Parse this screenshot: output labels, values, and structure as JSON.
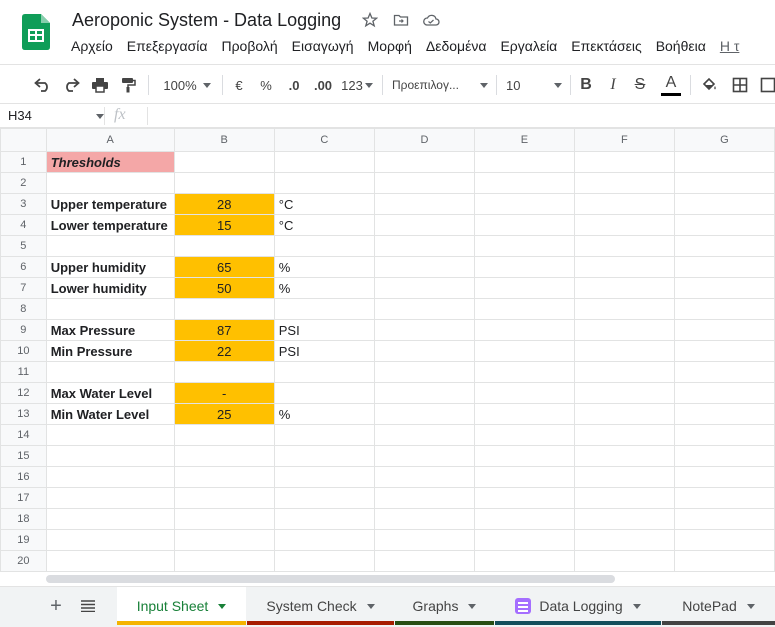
{
  "app": {
    "title": "Aeroponic System - Data Logging",
    "menu": [
      "Αρχείο",
      "Επεξεργασία",
      "Προβολή",
      "Εισαγωγή",
      "Μορφή",
      "Δεδομένα",
      "Εργαλεία",
      "Επεκτάσεις",
      "Βοήθεια",
      "Η τ"
    ]
  },
  "toolbar": {
    "zoom": "100%",
    "currency": "€",
    "percent": "%",
    "decrease_decimals": ".0",
    "increase_decimals": ".00",
    "format_more": "123",
    "font": "Προεπιλογ...",
    "font_size": "10",
    "bold": "B",
    "italic": "I",
    "strikethrough": "S",
    "text_color": "A"
  },
  "formula_bar": {
    "cell_ref": "H34",
    "fx": "fx"
  },
  "columns": [
    "A",
    "B",
    "C",
    "D",
    "E",
    "F",
    "G"
  ],
  "rows": [
    {
      "n": "1",
      "a": "Thresholds",
      "b": "",
      "c": ""
    },
    {
      "n": "2",
      "a": "",
      "b": "",
      "c": ""
    },
    {
      "n": "3",
      "a": "Upper temperature",
      "b": "28",
      "c": "°C"
    },
    {
      "n": "4",
      "a": "Lower temperature",
      "b": "15",
      "c": "°C"
    },
    {
      "n": "5",
      "a": "",
      "b": "",
      "c": ""
    },
    {
      "n": "6",
      "a": "Upper humidity",
      "b": "65",
      "c": "%"
    },
    {
      "n": "7",
      "a": "Lower humidity",
      "b": "50",
      "c": "%"
    },
    {
      "n": "8",
      "a": "",
      "b": "",
      "c": ""
    },
    {
      "n": "9",
      "a": "Max Pressure",
      "b": "87",
      "c": "PSI"
    },
    {
      "n": "10",
      "a": "Min Pressure",
      "b": "22",
      "c": "PSI"
    },
    {
      "n": "11",
      "a": "",
      "b": "",
      "c": ""
    },
    {
      "n": "12",
      "a": "Max Water Level",
      "b": "-",
      "c": ""
    },
    {
      "n": "13",
      "a": "Min Water Level",
      "b": "25",
      "c": "%"
    },
    {
      "n": "14",
      "a": "",
      "b": "",
      "c": ""
    },
    {
      "n": "15",
      "a": "",
      "b": "",
      "c": ""
    },
    {
      "n": "16",
      "a": "",
      "b": "",
      "c": ""
    },
    {
      "n": "17",
      "a": "",
      "b": "",
      "c": ""
    },
    {
      "n": "18",
      "a": "",
      "b": "",
      "c": ""
    },
    {
      "n": "19",
      "a": "",
      "b": "",
      "c": ""
    },
    {
      "n": "20",
      "a": "",
      "b": "",
      "c": ""
    }
  ],
  "tabs": [
    {
      "label": "Input Sheet",
      "active": true,
      "color": "#f4b400"
    },
    {
      "label": "System Check",
      "active": false,
      "color": "#a61c00"
    },
    {
      "label": "Graphs",
      "active": false,
      "color": "#274e13"
    },
    {
      "label": "Data Logging",
      "active": false,
      "color": "#134f5c"
    },
    {
      "label": "NotePad",
      "active": false,
      "color": "#434343"
    }
  ],
  "colors": {
    "threshold_fill": "#ffc000",
    "header_fill": "#f4a7a7",
    "brand_green": "#0f9d58"
  }
}
